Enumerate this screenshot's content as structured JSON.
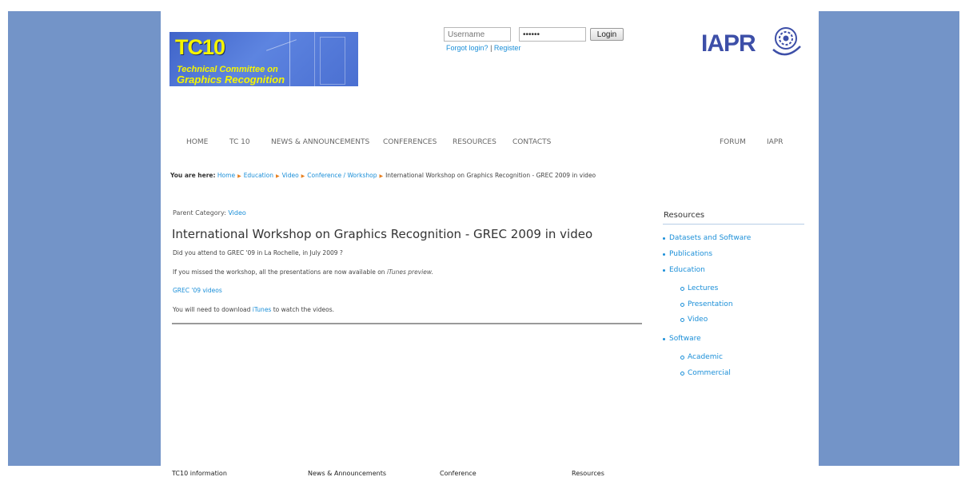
{
  "login": {
    "username_placeholder": "Username",
    "password_value": "••••••",
    "login_label": "Login",
    "forgot_label": "Forgot login?",
    "separator": "|",
    "register_label": "Register"
  },
  "logo": {
    "title": "TC10",
    "line1": "Technical Committee on",
    "line2": "Graphics Recognition"
  },
  "partner_logo": {
    "text": "IAPR"
  },
  "nav": {
    "items": [
      "HOME",
      "TC 10",
      "NEWS & ANNOUNCEMENTS",
      "CONFERENCES",
      "RESOURCES",
      "CONTACTS"
    ],
    "right_items": [
      "FORUM",
      "IAPR"
    ]
  },
  "breadcrumb": {
    "prefix": "You are here:",
    "items": [
      "Home",
      "Education",
      "Video",
      "Conference / Workshop"
    ],
    "current": "International Workshop on Graphics Recognition - GREC 2009 in video"
  },
  "article": {
    "parent_label": "Parent Category:",
    "parent_link": "Video",
    "title": "International Workshop on Graphics Recognition - GREC 2009 in video",
    "p1": "Did you attend to GREC '09 in La Rochelle, in July 2009 ?",
    "p2_text": "If you missed the workshop, all the presentations are now available on",
    "p2_italic": "iTunes preview.",
    "videos_link": "GREC '09 videos",
    "p4_before": "You will need to download",
    "p4_link": "iTunes",
    "p4_after": "to watch the videos."
  },
  "sidebar": {
    "title": "Resources",
    "items": [
      {
        "label": "Datasets and Software",
        "level": 1
      },
      {
        "label": "Publications",
        "level": 1
      },
      {
        "label": "Education",
        "level": 1
      },
      {
        "label": "Lectures",
        "level": 2
      },
      {
        "label": "Presentation",
        "level": 2
      },
      {
        "label": "Video",
        "level": 2
      },
      {
        "label": "Software",
        "level": 1
      },
      {
        "label": "Academic",
        "level": 2
      },
      {
        "label": "Commercial",
        "level": 2
      }
    ]
  },
  "footer": {
    "columns": [
      "TC10 information",
      "News & Announcements",
      "Conference",
      "Resources"
    ]
  },
  "colors": {
    "side_panels": "#7394c8",
    "link": "#1b8fd8",
    "breadcrumb_arrow": "#e87f1e",
    "iapr_brand": "#3d4fa8"
  }
}
